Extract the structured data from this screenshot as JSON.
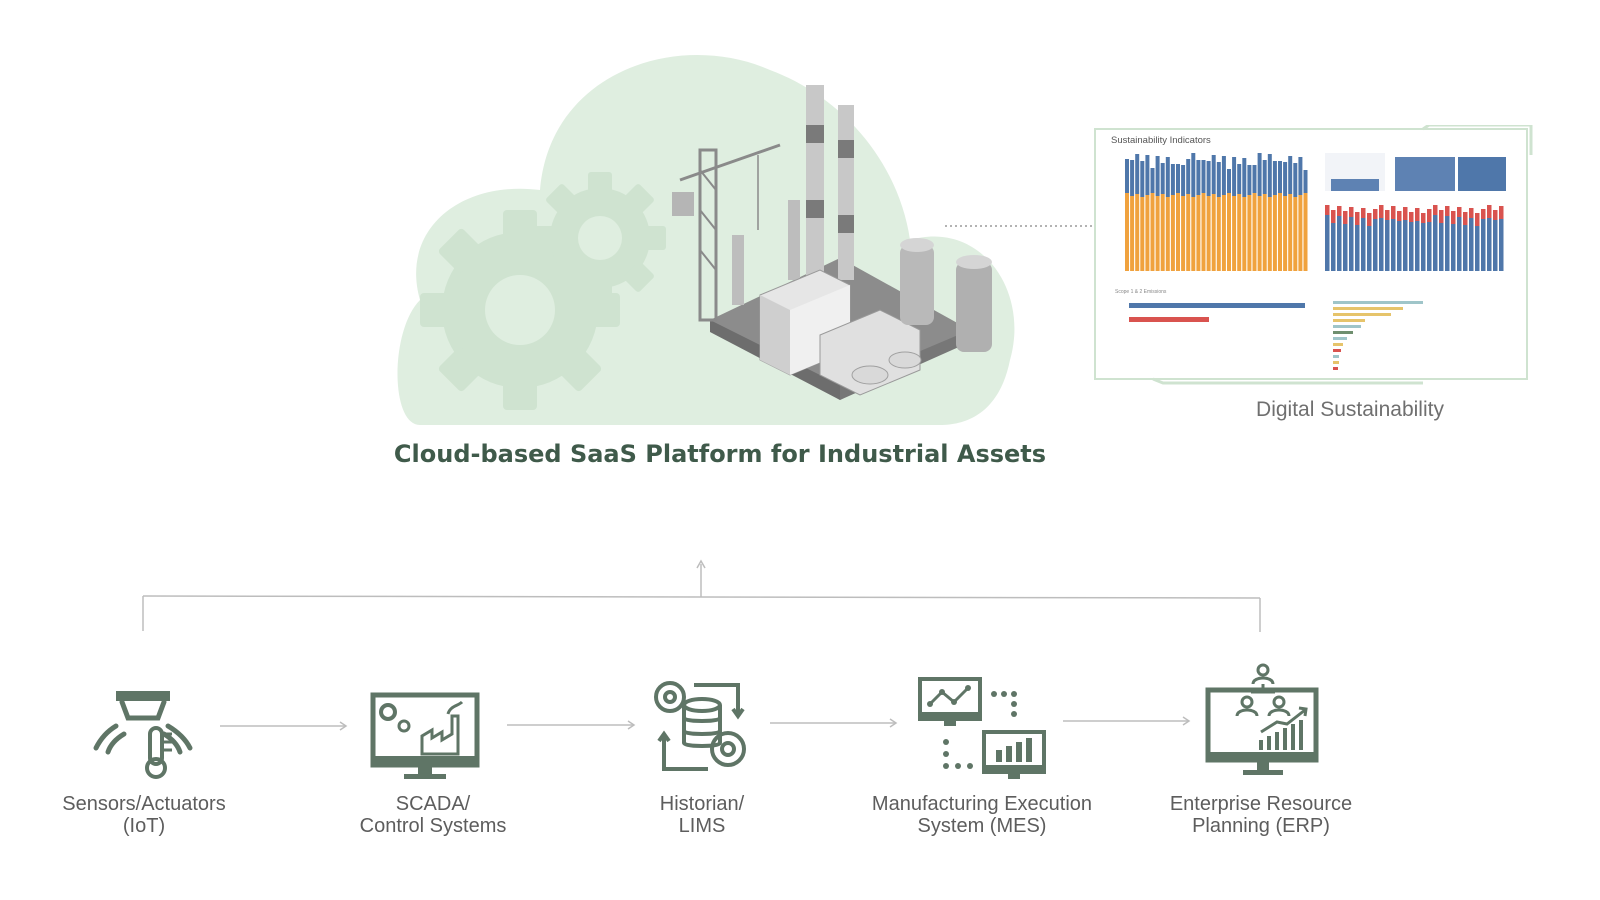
{
  "platform": {
    "title": "Cloud-based SaaS Platform for Industrial Assets"
  },
  "dashboard": {
    "title": "Sustainability Indicators",
    "caption": "Digital Sustainability"
  },
  "systems": [
    {
      "label": "Sensors/Actuators\n(IoT)",
      "icon": "sensor-thermometer-icon"
    },
    {
      "label": "SCADA/\nControl Systems",
      "icon": "scada-monitor-icon"
    },
    {
      "label": "Historian/\nLIMS",
      "icon": "database-gears-icon"
    },
    {
      "label": "Manufacturing Execution\nSystem (MES)",
      "icon": "mes-monitors-icon"
    },
    {
      "label": "Enterprise Resource\nPlanning (ERP)",
      "icon": "erp-monitor-icon"
    }
  ],
  "colors": {
    "accent": "#5f7566",
    "title": "#3f5a4a",
    "cloud": "#dfeee0",
    "gear": "#cfe3d0",
    "connector": "#bdbdbd",
    "chart_orange": "#f0a23e",
    "chart_blue": "#4f77aa",
    "chart_red": "#d9534f"
  }
}
